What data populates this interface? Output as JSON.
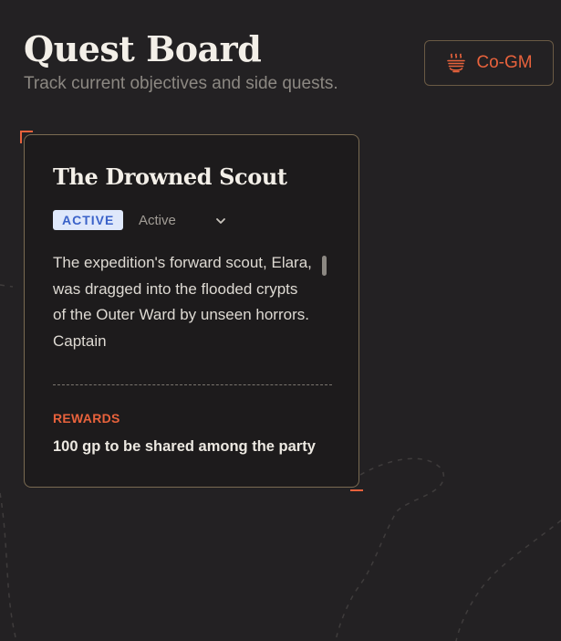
{
  "header": {
    "title": "Quest Board",
    "subtitle": "Track current objectives and side quests.",
    "cogm_button": {
      "label": "Co-GM",
      "icon": "bowl-steam-icon"
    }
  },
  "quest": {
    "title": "The Drowned Scout",
    "status_badge": "ACTIVE",
    "status_select": {
      "value": "Active",
      "icon": "chevron-down-icon"
    },
    "description": "The expedition's forward scout, Elara, was dragged into the flooded crypts of the Outer Ward by unseen horrors. Captain",
    "rewards_label": "REWARDS",
    "rewards_value": "100 gp to be shared among the party"
  },
  "colors": {
    "background": "#232123",
    "card_background": "#1d1b1c",
    "accent": "#e8623c",
    "card_border": "#7a6b52",
    "badge_background": "#dfe8fb",
    "badge_text": "#3a62c9"
  }
}
